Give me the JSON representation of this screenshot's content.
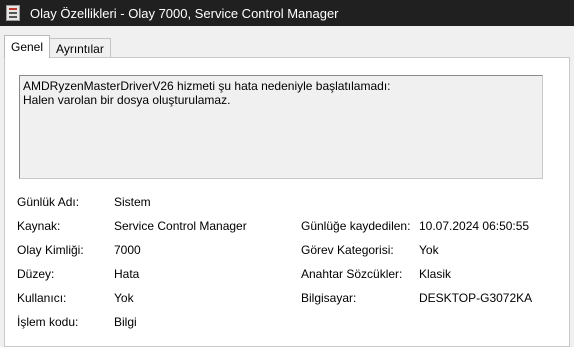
{
  "window": {
    "title": "Olay Özellikleri - Olay 7000, Service Control Manager",
    "icon": "event-viewer-icon"
  },
  "tabs": [
    {
      "label": "Genel",
      "active": true
    },
    {
      "label": "Ayrıntılar",
      "active": false
    }
  ],
  "description": {
    "lines": [
      "AMDRyzenMasterDriverV26 hizmeti şu hata nedeniyle başlatılamadı:",
      "Halen varolan bir dosya oluşturulamaz."
    ]
  },
  "fields": {
    "log_name": {
      "label": "Günlük Adı:",
      "value": "Sistem"
    },
    "source": {
      "label": "Kaynak:",
      "value": "Service Control Manager"
    },
    "logged": {
      "label": "Günlüğe kaydedilen:",
      "value": "10.07.2024 06:50:55"
    },
    "event_id": {
      "label": "Olay Kimliği:",
      "value": "7000"
    },
    "task_category": {
      "label": "Görev Kategorisi:",
      "value": "Yok"
    },
    "level": {
      "label": "Düzey:",
      "value": "Hata"
    },
    "keywords": {
      "label": "Anahtar Sözcükler:",
      "value": "Klasik"
    },
    "user": {
      "label": "Kullanıcı:",
      "value": "Yok"
    },
    "computer": {
      "label": "Bilgisayar:",
      "value": "DESKTOP-G3072KA"
    },
    "opcode": {
      "label": "İşlem kodu:",
      "value": "Bilgi"
    }
  }
}
